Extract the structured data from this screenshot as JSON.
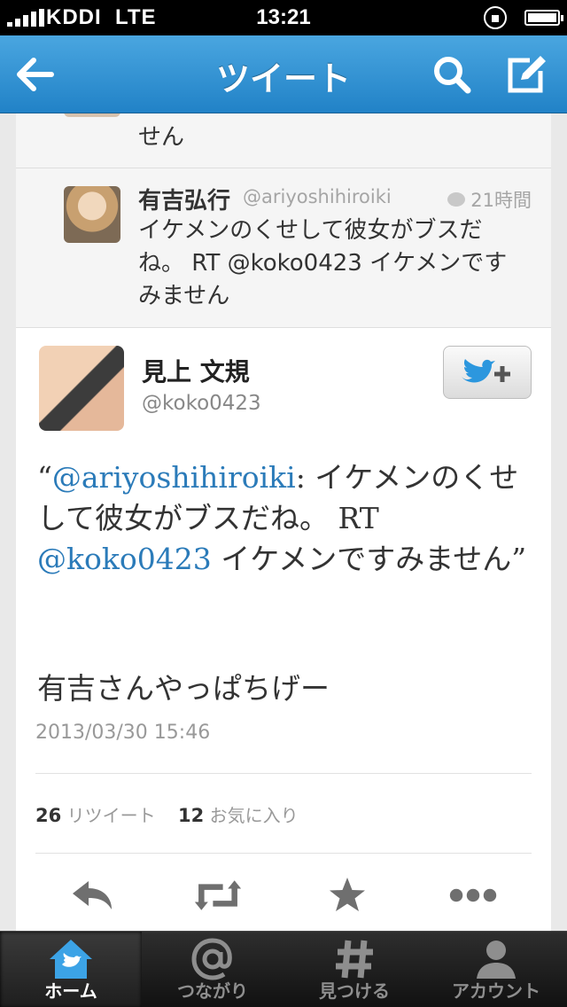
{
  "status_bar": {
    "carrier": "KDDI",
    "network": "LTE",
    "time": "13:21"
  },
  "nav": {
    "title": "ツイート",
    "back_icon": "back-arrow-icon",
    "search_icon": "search-icon",
    "compose_icon": "compose-icon"
  },
  "reply_top": {
    "text": "せん"
  },
  "reply": {
    "name": "有吉弘行",
    "handle": "@ariyoshihiroiki",
    "time": "21時間",
    "text": "イケメンのくせして彼女がブスだね。 RT @koko0423 イケメンですみません"
  },
  "tweet": {
    "name": "見上 文規",
    "handle": "@koko0423",
    "open_quote": "“",
    "mention_1": "@ariyoshihiroiki",
    "text_1": ": イケメンのくせして彼女がブスだね。 RT ",
    "mention_2": "@koko0423",
    "text_2": " イケメンですみません”",
    "comment": "有吉さんやっぱちげー",
    "date": "2013/03/30 15:46",
    "retweet_count": "26",
    "retweet_label": "リツイート",
    "favorite_count": "12",
    "favorite_label": "お気に入り"
  },
  "tabs": [
    {
      "label": "ホーム",
      "icon": "home-icon",
      "active": true
    },
    {
      "label": "つながり",
      "icon": "at-icon",
      "active": false
    },
    {
      "label": "見つける",
      "icon": "hash-icon",
      "active": false
    },
    {
      "label": "アカウント",
      "icon": "user-icon",
      "active": false
    }
  ],
  "colors": {
    "nav_blue": "#2b8bd1",
    "link": "#2b7bb9",
    "tab_bg": "#1a1a1a"
  }
}
